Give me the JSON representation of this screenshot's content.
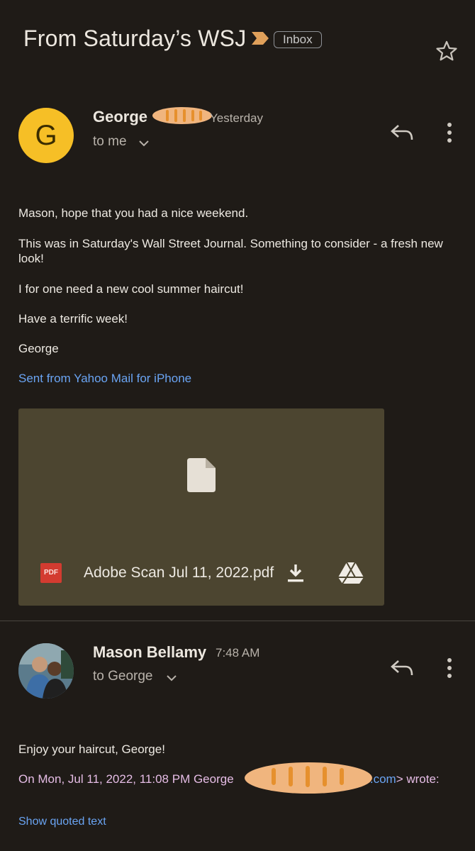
{
  "thread": {
    "subject": "From Saturday’s WSJ",
    "label": "Inbox",
    "importance_color": "#e0a05a"
  },
  "message1": {
    "avatar_letter": "G",
    "avatar_color": "#f6bf26",
    "sender": "George",
    "time": "Yesterday",
    "recipient": "to me",
    "body": {
      "line1": "Mason, hope that you had a nice weekend.",
      "line2": "This was in Saturday's Wall Street Journal.   Something to consider - a fresh new look!",
      "line3": "I for one need a new cool summer haircut!",
      "line4": "Have a terrific week!",
      "line5": "George",
      "signature_link": "Sent from Yahoo Mail for iPhone"
    },
    "attachment": {
      "type_badge": "PDF",
      "filename": "Adobe Scan Jul 11, 2022.pdf"
    }
  },
  "message2": {
    "sender": "Mason Bellamy",
    "time": "7:48 AM",
    "recipient": "to George",
    "body": "Enjoy your haircut, George!",
    "quoted_prefix": "On Mon, Jul 11, 2022, 11:08 PM George ",
    "quoted_link": "o.com",
    "quoted_suffix": "> wrote:",
    "show_quoted": "Show quoted text"
  }
}
